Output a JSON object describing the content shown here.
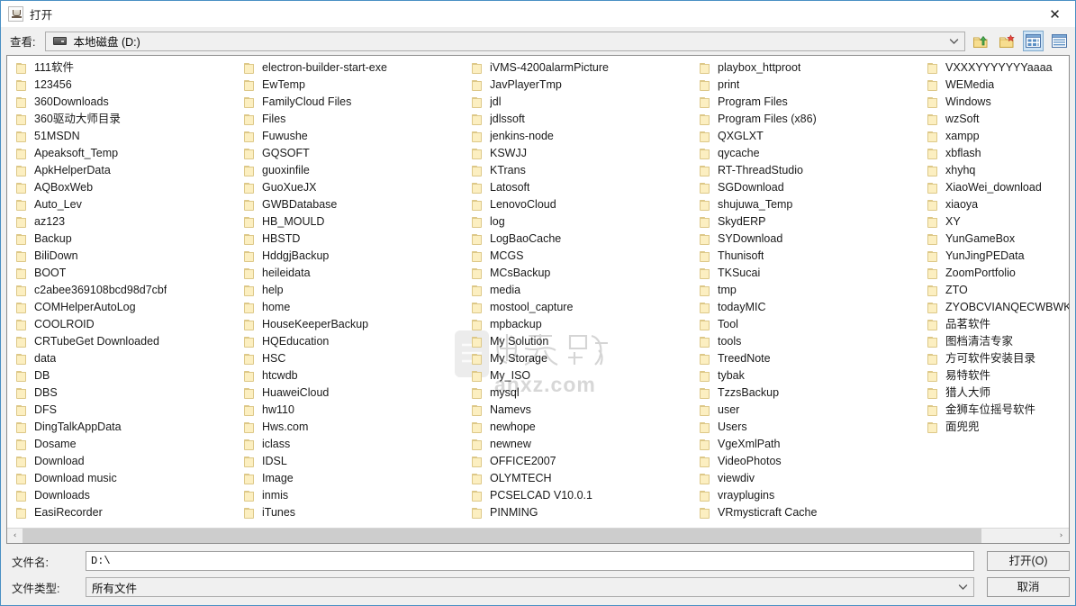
{
  "window": {
    "title": "打开",
    "app_icon": "java-coffee-cup-icon",
    "close_label": "✕"
  },
  "toolbar": {
    "lookin_label": "查看:",
    "current_path": "本地磁盘 (D:)",
    "drive_icon": "hard-drive-icon",
    "combo_arrow_icon": "chevron-down-icon",
    "buttons": [
      {
        "name": "up-one-level-button",
        "icon": "folder-up-arrow-icon",
        "selected": false
      },
      {
        "name": "create-new-folder-button",
        "icon": "new-folder-icon",
        "selected": false
      },
      {
        "name": "list-view-button",
        "icon": "tiles-view-icon",
        "selected": true
      },
      {
        "name": "details-view-button",
        "icon": "details-view-icon",
        "selected": false
      }
    ]
  },
  "watermark": {
    "text": "anxz.com",
    "outline_text": "数下载"
  },
  "scrollbar": {
    "left_arrow": "‹",
    "right_arrow": "›",
    "thumb_percent": 93
  },
  "file_list": {
    "columns": [
      {
        "items": [
          "111软件",
          "123456",
          "360Downloads",
          "360驱动大师目录",
          "51MSDN",
          "Apeaksoft_Temp",
          "ApkHelperData",
          "AQBoxWeb",
          "Auto_Lev",
          "az123",
          "Backup",
          "BiliDown",
          "BOOT",
          "c2abee369108bcd98d7cbf",
          "COMHelperAutoLog",
          "COOLROID",
          "CRTubeGet Downloaded",
          "data",
          "DB",
          "DBS",
          "DFS",
          "DingTalkAppData",
          "Dosame",
          "Download",
          "Download music",
          "Downloads",
          "EasiRecorder"
        ]
      },
      {
        "items": [
          "electron-builder-start-exe",
          "EwTemp",
          "FamilyCloud Files",
          "Files",
          "Fuwushe",
          "GQSOFT",
          "guoxinfile",
          "GuoXueJX",
          "GWBDatabase",
          "HB_MOULD",
          "HBSTD",
          "HddgjBackup",
          "heileidata",
          "help",
          "home",
          "HouseKeeperBackup",
          "HQEducation",
          "HSC",
          "htcwdb",
          "HuaweiCloud",
          "hw110",
          "Hws.com",
          "iclass",
          "IDSL",
          "Image",
          "inmis",
          "iTunes"
        ]
      },
      {
        "items": [
          "iVMS-4200alarmPicture",
          "JavPlayerTmp",
          "jdl",
          "jdlssoft",
          "jenkins-node",
          "KSWJJ",
          "KTrans",
          "Latosoft",
          "LenovoCloud",
          "log",
          "LogBaoCache",
          "MCGS",
          "MCsBackup",
          "media",
          "mostool_capture",
          "mpbackup",
          "My Solution",
          "My Storage",
          "My_ISO",
          "mysql",
          "Namevs",
          "newhope",
          "newnew",
          "OFFICE2007",
          "OLYMTECH",
          "PCSELCAD V10.0.1",
          "PINMING"
        ]
      },
      {
        "items": [
          "playbox_httproot",
          "print",
          "Program Files",
          "Program Files (x86)",
          "QXGLXT",
          "qycache",
          "RT-ThreadStudio",
          "SGDownload",
          "shujuwa_Temp",
          "SkydERP",
          "SYDownload",
          "Thunisoft",
          "TKSucai",
          "tmp",
          "todayMIC",
          "Tool",
          "tools",
          "TreedNote",
          "tybak",
          "TzzsBackup",
          "user",
          "Users",
          "VgeXmlPath",
          "VideoPhotos",
          "viewdiv",
          "vrayplugins",
          "VRmysticraft Cache"
        ]
      },
      {
        "items": [
          "VXXXYYYYYYYaaaa",
          "WEMedia",
          "Windows",
          "wzSoft",
          "xampp",
          "xbflash",
          "xhyhq",
          "XiaoWei_download",
          "xiaoya",
          "XY",
          "YunGameBox",
          "YunJingPEData",
          "ZoomPortfolio",
          "ZTO",
          "ZYOBCVIANQECWBWKP",
          "品茗软件",
          "图档清洁专家",
          "方可软件安装目录",
          "易特软件",
          "猎人大师",
          "金狮车位摇号软件",
          "面兜兜"
        ]
      }
    ]
  },
  "form": {
    "filename_label": "文件名:",
    "filename_value": "D:\\",
    "filetype_label": "文件类型:",
    "filetype_value": "所有文件",
    "filetype_arrow_icon": "chevron-down-icon"
  },
  "actions": {
    "open_label": "打开(O)",
    "cancel_label": "取消"
  },
  "colors": {
    "dialog_border": "#4a90c4",
    "dialog_bg": "#f0f0f0",
    "list_bg": "#ffffff",
    "folder_fill": "#fcefc1",
    "folder_stroke": "#ddc888",
    "selected_tool_bg": "#cde3f5",
    "text": "#1a1a1a"
  }
}
